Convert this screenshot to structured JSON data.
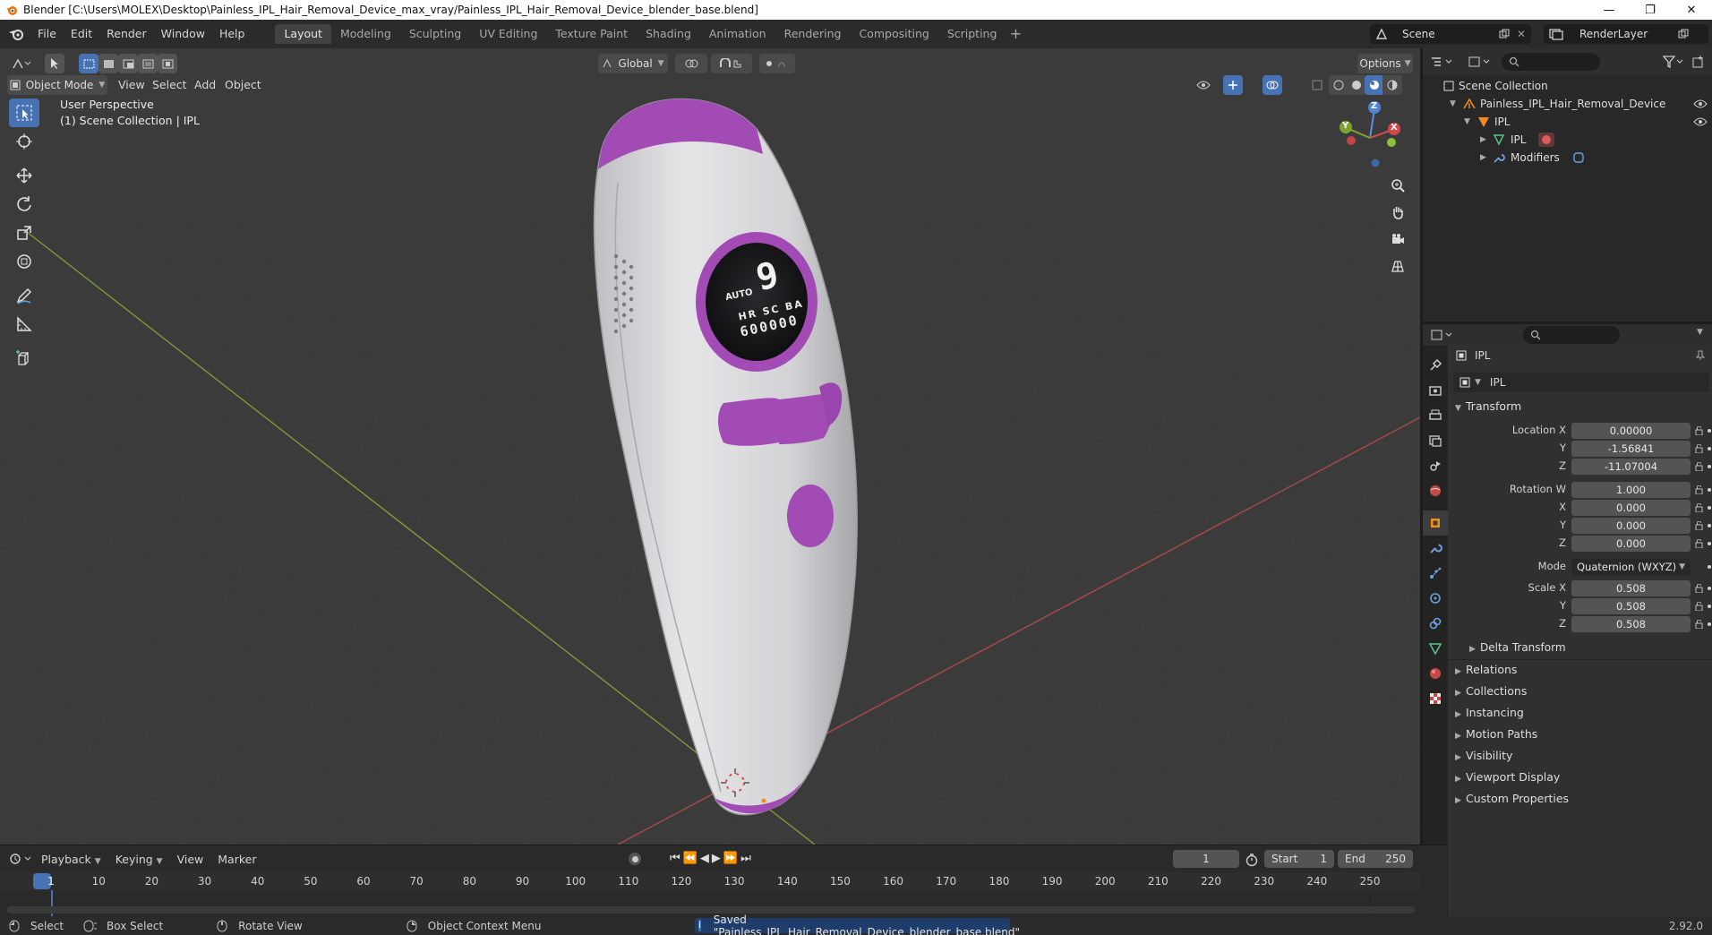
{
  "window": {
    "title": "Blender [C:\\Users\\MOLEX\\Desktop\\Painless_IPL_Hair_Removal_Device_max_vray/Painless_IPL_Hair_Removal_Device_blender_base.blend]",
    "minimize": "—",
    "restore": "❐",
    "close": "✕"
  },
  "menus": [
    "File",
    "Edit",
    "Render",
    "Window",
    "Help"
  ],
  "workspaces": [
    "Layout",
    "Modeling",
    "Sculpting",
    "UV Editing",
    "Texture Paint",
    "Shading",
    "Animation",
    "Rendering",
    "Compositing",
    "Scripting"
  ],
  "active_workspace": "Layout",
  "scene": {
    "name": "Scene",
    "render_layer": "RenderLayer"
  },
  "viewport": {
    "mode": "Object Mode",
    "menus": [
      "View",
      "Select",
      "Add",
      "Object"
    ],
    "transform_orientation": "Global",
    "options_label": "Options",
    "perspective": "User Perspective",
    "collection_info": "(1) Scene Collection | IPL",
    "gizmo": {
      "x": "X",
      "y": "Y",
      "z": "Z"
    }
  },
  "device_screen": {
    "big": "9",
    "line1": "AUTO",
    "line2": "HR SC BA",
    "line3": "600000"
  },
  "outliner": {
    "root": "Scene Collection",
    "collection": "Painless_IPL_Hair_Removal_Device",
    "object": "IPL",
    "mesh": "IPL",
    "modifiers": "Modifiers"
  },
  "properties": {
    "object_name": "IPL",
    "data_name": "IPL",
    "transform_label": "Transform",
    "location": {
      "label": "Location X",
      "x": "0.00000",
      "y": "-1.56841",
      "z": "-11.07004"
    },
    "rotation": {
      "label": "Rotation W",
      "w": "1.000",
      "x": "0.000",
      "y": "0.000",
      "z": "0.000"
    },
    "mode": {
      "label": "Mode",
      "value": "Quaternion (WXYZ)"
    },
    "scale": {
      "label": "Scale X",
      "x": "0.508",
      "y": "0.508",
      "z": "0.508"
    },
    "axis_labels": {
      "y": "Y",
      "z": "Z",
      "x": "X"
    },
    "sections": [
      "Delta Transform",
      "Relations",
      "Collections",
      "Instancing",
      "Motion Paths",
      "Visibility",
      "Viewport Display",
      "Custom Properties"
    ]
  },
  "timeline": {
    "menus": [
      "Playback",
      "Keying",
      "View",
      "Marker"
    ],
    "current_frame": "1",
    "start_label": "Start",
    "start": "1",
    "end_label": "End",
    "end": "250",
    "ruler": [
      "1",
      "10",
      "20",
      "30",
      "40",
      "50",
      "60",
      "70",
      "80",
      "90",
      "100",
      "110",
      "120",
      "130",
      "140",
      "150",
      "160",
      "170",
      "180",
      "190",
      "200",
      "210",
      "220",
      "230",
      "240",
      "250"
    ]
  },
  "statusbar": {
    "select": "Select",
    "box_select": "Box Select",
    "rotate_view": "Rotate View",
    "context_menu": "Object Context Menu",
    "message": "Saved \"Painless_IPL_Hair_Removal_Device_blender_base.blend\"",
    "version": "2.92.0"
  },
  "colors": {
    "accent": "#4772b3",
    "purple": "#a24bb5",
    "body": "#d8d8db",
    "viewport_bg": "#3b3b3b"
  }
}
